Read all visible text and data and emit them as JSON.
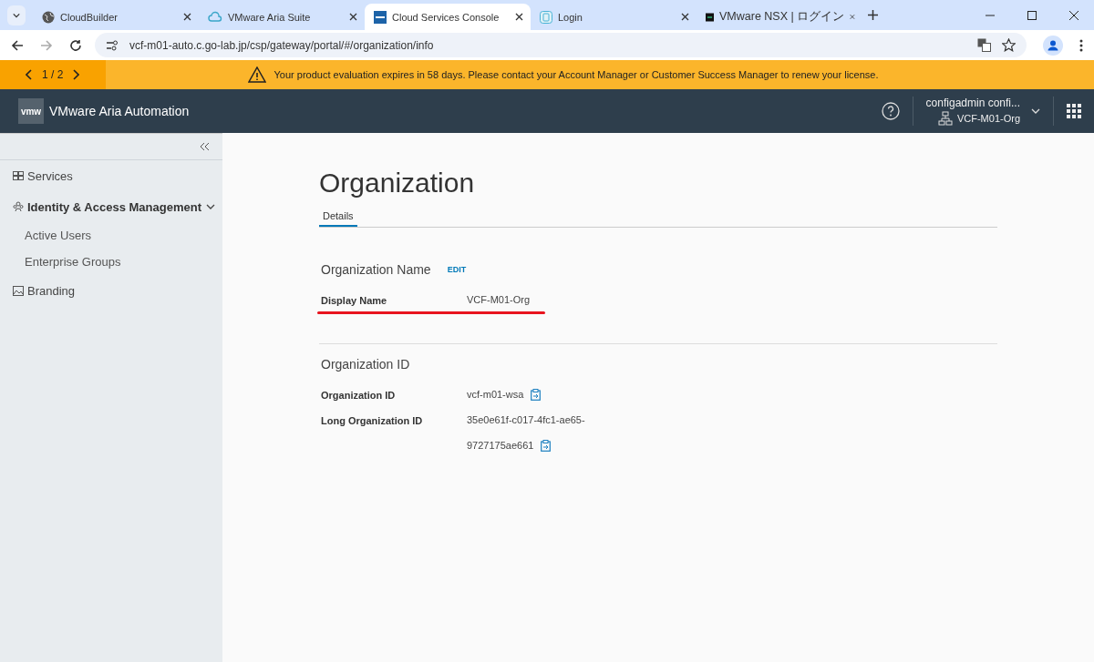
{
  "browser": {
    "tabs": [
      {
        "title": "CloudBuilder",
        "kind": "globe",
        "selected": false
      },
      {
        "title": "VMware Aria Suite",
        "kind": "cloud",
        "selected": false
      },
      {
        "title": "Cloud Services Console",
        "kind": "vmw",
        "selected": true
      },
      {
        "title": "Login",
        "kind": "login",
        "selected": false
      },
      {
        "title": "VMware NSX | ログイン",
        "kind": "nsx",
        "selected": false
      }
    ],
    "url": "vcf-m01-auto.c.go-lab.jp/csp/gateway/portal/#/organization/info"
  },
  "banner": {
    "pager": "1 / 2",
    "message": "Your product evaluation expires in 58 days. Please contact your Account Manager or Customer Success Manager to renew your license."
  },
  "header": {
    "logo": "vmw",
    "product": "VMware Aria Automation",
    "user": "configadmin confi...",
    "org": "VCF-M01-Org"
  },
  "sidebar": {
    "items": [
      {
        "label": "Services",
        "kind": "services"
      },
      {
        "label": "Identity & Access Management",
        "kind": "identity",
        "expanded": true,
        "children": [
          {
            "label": "Active Users"
          },
          {
            "label": "Enterprise Groups"
          }
        ]
      },
      {
        "label": "Branding",
        "kind": "branding"
      }
    ]
  },
  "page": {
    "title": "Organization",
    "tabs": [
      {
        "label": "Details",
        "selected": true
      }
    ],
    "sections": [
      {
        "title": "Organization Name",
        "action": "EDIT",
        "fields": [
          {
            "label": "Display Name",
            "values": [
              "VCF-M01-Org"
            ],
            "copyable": false,
            "highlighted": true
          }
        ]
      },
      {
        "title": "Organization ID",
        "fields": [
          {
            "label": "Organization ID",
            "values": [
              "vcf-m01-wsa"
            ],
            "copyable": true,
            "highlighted": false
          },
          {
            "label": "Long Organization ID",
            "values": [
              "35e0e61f-c017-4fc1-ae65-",
              "9727175ae661"
            ],
            "copyable": true,
            "highlighted": false
          }
        ]
      }
    ]
  }
}
